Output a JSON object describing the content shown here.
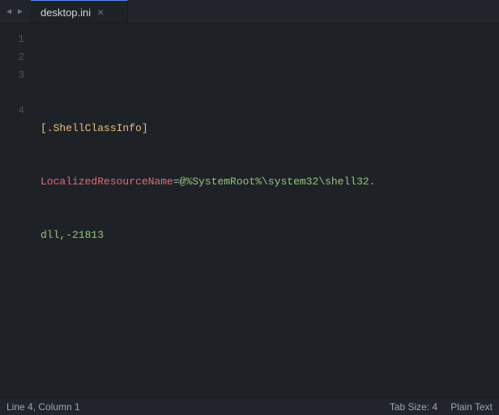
{
  "titleBar": {
    "navLeft": "◀",
    "navRight": "▶"
  },
  "tab": {
    "label": "desktop.ini",
    "closeIcon": "×",
    "active": true
  },
  "editor": {
    "lines": [
      {
        "number": "1",
        "content": ""
      },
      {
        "number": "2",
        "content": "[.ShellClassInfo]"
      },
      {
        "number": "3",
        "content": "LocalizedResourceName=@%SystemRoot%\\system32\\shell32.dll,-21813"
      },
      {
        "number": "4",
        "content": ""
      }
    ]
  },
  "statusBar": {
    "position": "Line 4, Column 1",
    "tabSize": "Tab Size: 4",
    "language": "Plain Text"
  }
}
